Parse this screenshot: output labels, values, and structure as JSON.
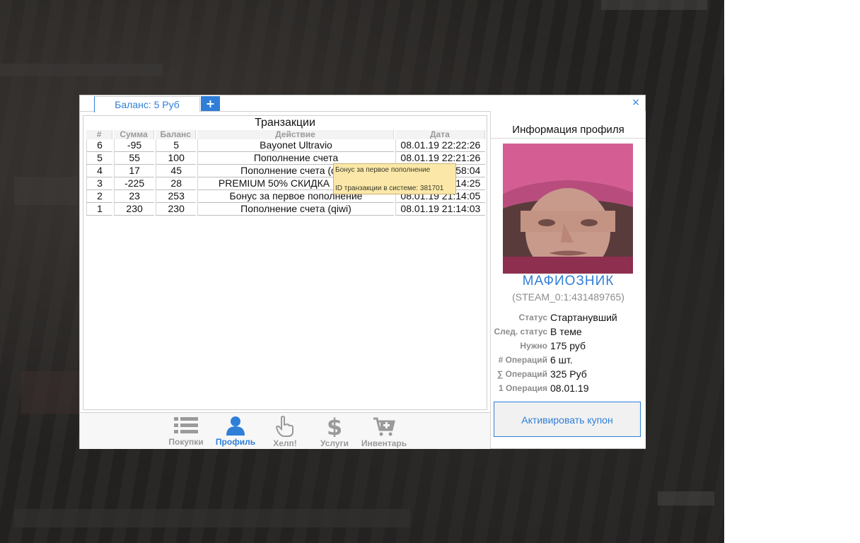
{
  "window": {
    "balance_tab": "Баланс: 5 Руб",
    "plus": "+",
    "close": "×"
  },
  "transactions": {
    "title": "Транзакции",
    "columns": [
      "#",
      "Сумма",
      "Баланс",
      "Действие",
      "Дата"
    ],
    "rows": [
      {
        "n": "6",
        "sum": "-95",
        "bal": "5",
        "act": "Bayonet Ultravio",
        "date": "08.01.19 22:22:26"
      },
      {
        "n": "5",
        "sum": "55",
        "bal": "100",
        "act": "Пополнение счета",
        "date": "08.01.19 22:21:26"
      },
      {
        "n": "4",
        "sum": "17",
        "bal": "45",
        "act": "Пополнение счета (qiwi)",
        "date": "08.01.19 22:58:04"
      },
      {
        "n": "3",
        "sum": "-225",
        "bal": "28",
        "act": "PREMIUM 50% СКИДКА навсегда",
        "date": "08.01.19 21:14:25"
      },
      {
        "n": "2",
        "sum": "23",
        "bal": "253",
        "act": "Бонус за первое пополнение",
        "date": "08.01.19 21:14:05"
      },
      {
        "n": "1",
        "sum": "230",
        "bal": "230",
        "act": "Пополнение счета (qiwi)",
        "date": "08.01.19 21:14:03"
      }
    ],
    "tooltip": {
      "line1": "Бонус за первое пополнение",
      "line2": "ID транзакции в системе: 381701"
    }
  },
  "nav": {
    "items": [
      {
        "label": "Покупки",
        "icon": "list-icon"
      },
      {
        "label": "Профиль",
        "icon": "user-icon"
      },
      {
        "label": "Хелп!",
        "icon": "hand-pointer-icon"
      },
      {
        "label": "Услуги",
        "icon": "dollar-icon"
      },
      {
        "label": "Инвентарь",
        "icon": "cart-plus-icon"
      }
    ],
    "active": "Профиль"
  },
  "profile": {
    "header": "Информация профиля",
    "name": "МАФИОЗНИК",
    "steam": "(STEAM_0:1:431489765)",
    "stats": [
      {
        "key": "Статус",
        "val": "Стартанувший"
      },
      {
        "key": "След. статус",
        "val": "В теме"
      },
      {
        "key": "Нужно",
        "val": "175 руб"
      },
      {
        "key": "# Операций",
        "val": "6 шт."
      },
      {
        "key": "∑ Операций",
        "val": "325 Руб"
      },
      {
        "key": "1 Операция",
        "val": "08.01.19"
      }
    ],
    "coupon_button": "Активировать купон"
  },
  "colors": {
    "accent": "#2f7fd8",
    "tooltip_bg": "#fbe8a8",
    "muted": "#9a9a9a"
  }
}
